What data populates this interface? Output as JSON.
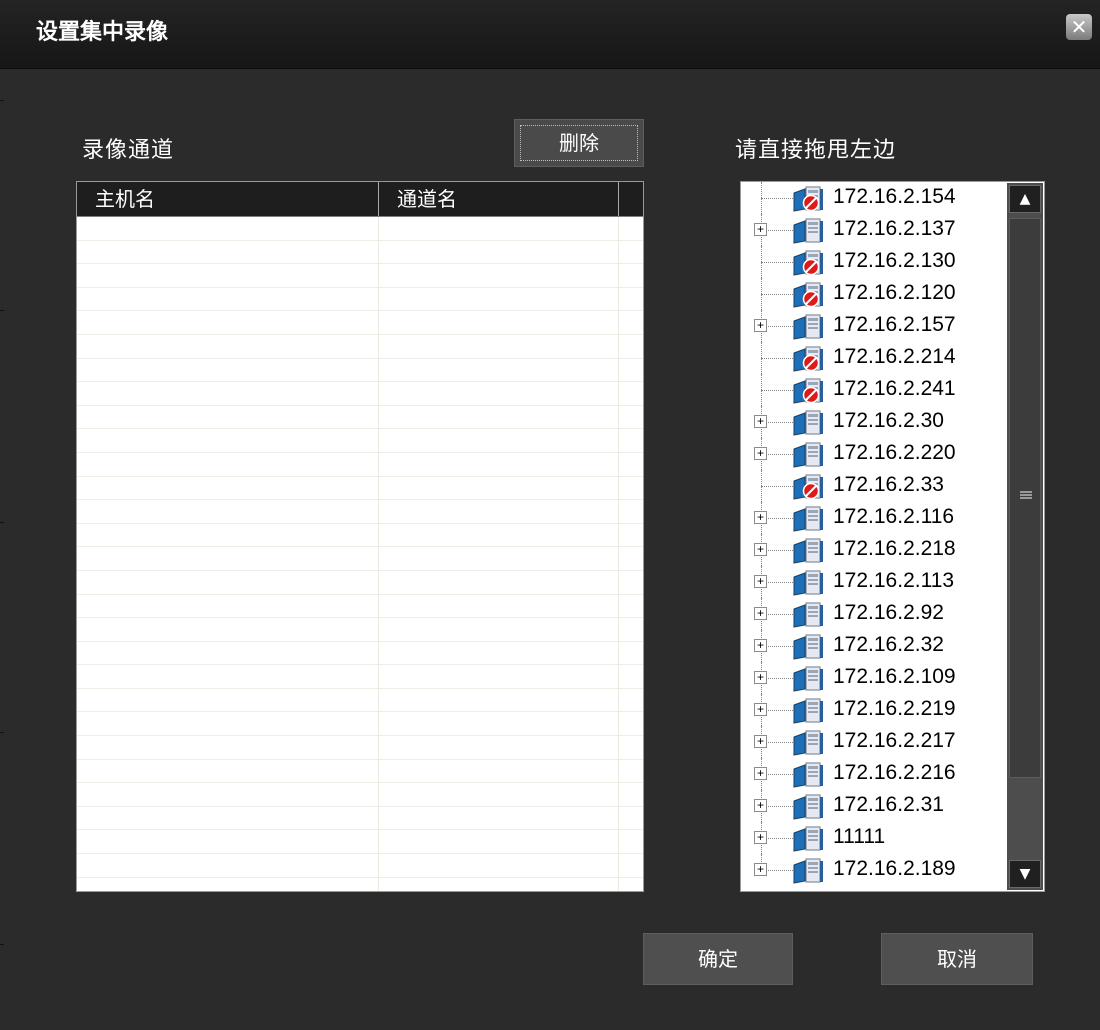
{
  "window": {
    "title": "设置集中录像",
    "close_icon": "close-icon"
  },
  "left": {
    "label": "录像通道",
    "delete_button": "删除",
    "columns": [
      "主机名",
      "通道名"
    ],
    "rows": []
  },
  "right": {
    "label": "请直接拖甩左边",
    "tree_nodes": [
      {
        "label": "172.16.2.154",
        "status": "offline",
        "expandable": false
      },
      {
        "label": "172.16.2.137",
        "status": "online",
        "expandable": true
      },
      {
        "label": "172.16.2.130",
        "status": "offline",
        "expandable": false
      },
      {
        "label": "172.16.2.120",
        "status": "offline",
        "expandable": false
      },
      {
        "label": "172.16.2.157",
        "status": "online",
        "expandable": true
      },
      {
        "label": "172.16.2.214",
        "status": "offline",
        "expandable": false
      },
      {
        "label": "172.16.2.241",
        "status": "offline",
        "expandable": false
      },
      {
        "label": "172.16.2.30",
        "status": "online",
        "expandable": true
      },
      {
        "label": "172.16.2.220",
        "status": "online",
        "expandable": true
      },
      {
        "label": "172.16.2.33",
        "status": "offline",
        "expandable": false
      },
      {
        "label": "172.16.2.116",
        "status": "online",
        "expandable": true
      },
      {
        "label": "172.16.2.218",
        "status": "online",
        "expandable": true
      },
      {
        "label": "172.16.2.113",
        "status": "online",
        "expandable": true
      },
      {
        "label": "172.16.2.92",
        "status": "online",
        "expandable": true
      },
      {
        "label": "172.16.2.32",
        "status": "online",
        "expandable": true
      },
      {
        "label": "172.16.2.109",
        "status": "online",
        "expandable": true
      },
      {
        "label": "172.16.2.219",
        "status": "online",
        "expandable": true
      },
      {
        "label": "172.16.2.217",
        "status": "online",
        "expandable": true
      },
      {
        "label": "172.16.2.216",
        "status": "online",
        "expandable": true
      },
      {
        "label": "172.16.2.31",
        "status": "online",
        "expandable": true
      },
      {
        "label": "11111",
        "status": "online",
        "expandable": true
      },
      {
        "label": "172.16.2.189",
        "status": "online",
        "expandable": true
      }
    ]
  },
  "footer": {
    "confirm_button": "确定",
    "cancel_button": "取消"
  },
  "colors": {
    "background": "#2b2b2b",
    "titlebar": "#1a1a1a",
    "button": "#4a4a4a",
    "offline_badge": "#e01818",
    "host_icon": "#1f6fb8"
  }
}
